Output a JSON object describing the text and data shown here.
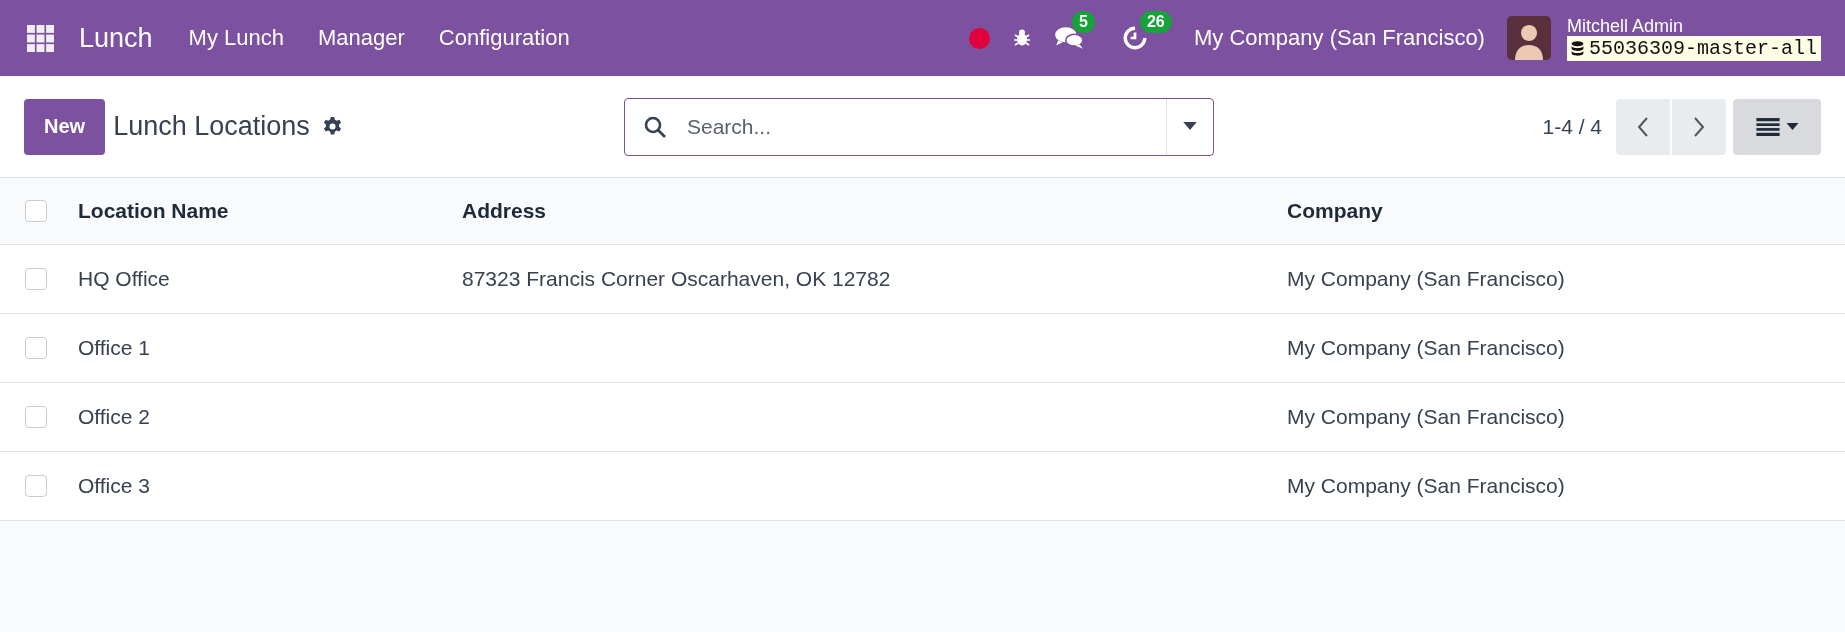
{
  "navbar": {
    "app_name": "Lunch",
    "menu": [
      "My Lunch",
      "Manager",
      "Configuration"
    ],
    "messages_count": "5",
    "activities_count": "26",
    "company": "My Company (San Francisco)",
    "user_name": "Mitchell Admin",
    "database": "55036309-master-all"
  },
  "control_panel": {
    "new_button": "New",
    "title": "Lunch Locations",
    "search": {
      "placeholder": "Search..."
    },
    "pager": "1-4 / 4"
  },
  "table": {
    "select_all_checked": false,
    "columns": [
      "Location Name",
      "Address",
      "Company"
    ],
    "rows": [
      {
        "checked": false,
        "cells": [
          "HQ Office",
          "87323 Francis Corner Oscarhaven, OK 12782",
          "My Company (San Francisco)"
        ]
      },
      {
        "checked": false,
        "cells": [
          "Office 1",
          "",
          "My Company (San Francisco)"
        ]
      },
      {
        "checked": false,
        "cells": [
          "Office 2",
          "",
          "My Company (San Francisco)"
        ]
      },
      {
        "checked": false,
        "cells": [
          "Office 3",
          "",
          "My Company (San Francisco)"
        ]
      }
    ]
  }
}
